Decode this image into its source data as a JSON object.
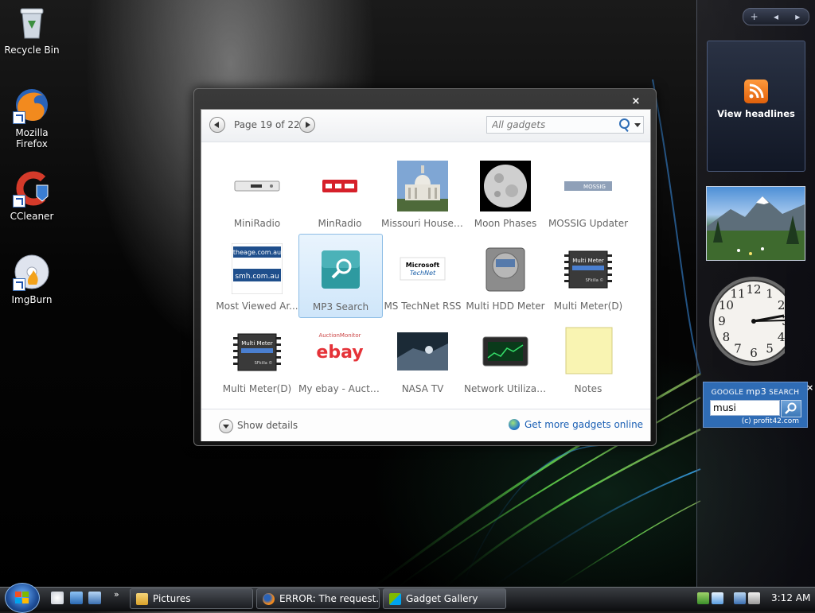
{
  "desktop": {
    "icons": [
      {
        "label": "Recycle Bin",
        "icon": "recycle-bin-icon"
      },
      {
        "label": "Mozilla Firefox",
        "icon": "firefox-icon"
      },
      {
        "label": "CCleaner",
        "icon": "ccleaner-icon"
      },
      {
        "label": "ImgBurn",
        "icon": "imgburn-icon"
      }
    ]
  },
  "sidebar": {
    "controls": {
      "add": "+",
      "prev": "◂",
      "next": "▸"
    },
    "rss": {
      "label": "View headlines",
      "icon": "rss-icon"
    },
    "clock": {
      "numerals": [
        "12",
        "1",
        "2",
        "3",
        "4",
        "5",
        "6",
        "7",
        "8",
        "9",
        "10",
        "11"
      ]
    },
    "google_search": {
      "header_prefix": "GOOGLE ",
      "header_brand": "mp3",
      "header_suffix": " SEARCH",
      "value": "musi",
      "copyright": "(c) profit42.com",
      "close": "×"
    }
  },
  "gallery": {
    "close": "×",
    "page_text": "Page 19 of 22",
    "search_placeholder": "All gadgets",
    "gadgets": [
      {
        "label": "MiniRadio",
        "icon": "mini-radio-icon"
      },
      {
        "label": "MinRadio",
        "icon": "min-radio-icon"
      },
      {
        "label": "Missouri House ...",
        "icon": "missouri-house-icon"
      },
      {
        "label": "Moon Phases",
        "icon": "moon-icon"
      },
      {
        "label": "MOSSIG Updater",
        "icon": "mossig-icon"
      },
      {
        "label": "Most Viewed Ar...",
        "icon": "news-icon"
      },
      {
        "label": "MP3 Search",
        "icon": "magnifier-icon",
        "selected": true
      },
      {
        "label": "MS TechNet RSS",
        "icon": "technet-icon"
      },
      {
        "label": "Multi HDD Meter",
        "icon": "hdd-icon"
      },
      {
        "label": "Multi Meter(D)",
        "icon": "chip-icon"
      },
      {
        "label": "Multi Meter(D)",
        "icon": "chip-icon"
      },
      {
        "label": "My ebay - Aucti...",
        "icon": "ebay-icon"
      },
      {
        "label": "NASA TV",
        "icon": "nasa-tv-icon"
      },
      {
        "label": "Network Utilizat...",
        "icon": "network-monitor-icon"
      },
      {
        "label": "Notes",
        "icon": "sticky-note-icon"
      }
    ],
    "thumb_text": {
      "technet_1": "Microsoft",
      "technet_2": "TechNet",
      "news_1": "theage.com.au",
      "news_2": "smh.com.au",
      "meter_1": "Multi Meter",
      "meter_2": "SFkilla ©",
      "ebay_top": "AuctionMonitor",
      "ebay_logo": "ebay",
      "mossig": "MOSSIG"
    },
    "show_details": "Show details",
    "more_link": "Get more gadgets online"
  },
  "taskbar": {
    "chevron": "»",
    "buttons": [
      {
        "label": "Pictures",
        "icon": "folder-icon"
      },
      {
        "label": "ERROR: The request...",
        "icon": "firefox-icon"
      },
      {
        "label": "Gadget Gallery",
        "icon": "gadget-gallery-icon"
      }
    ],
    "time": "3:12 AM"
  }
}
